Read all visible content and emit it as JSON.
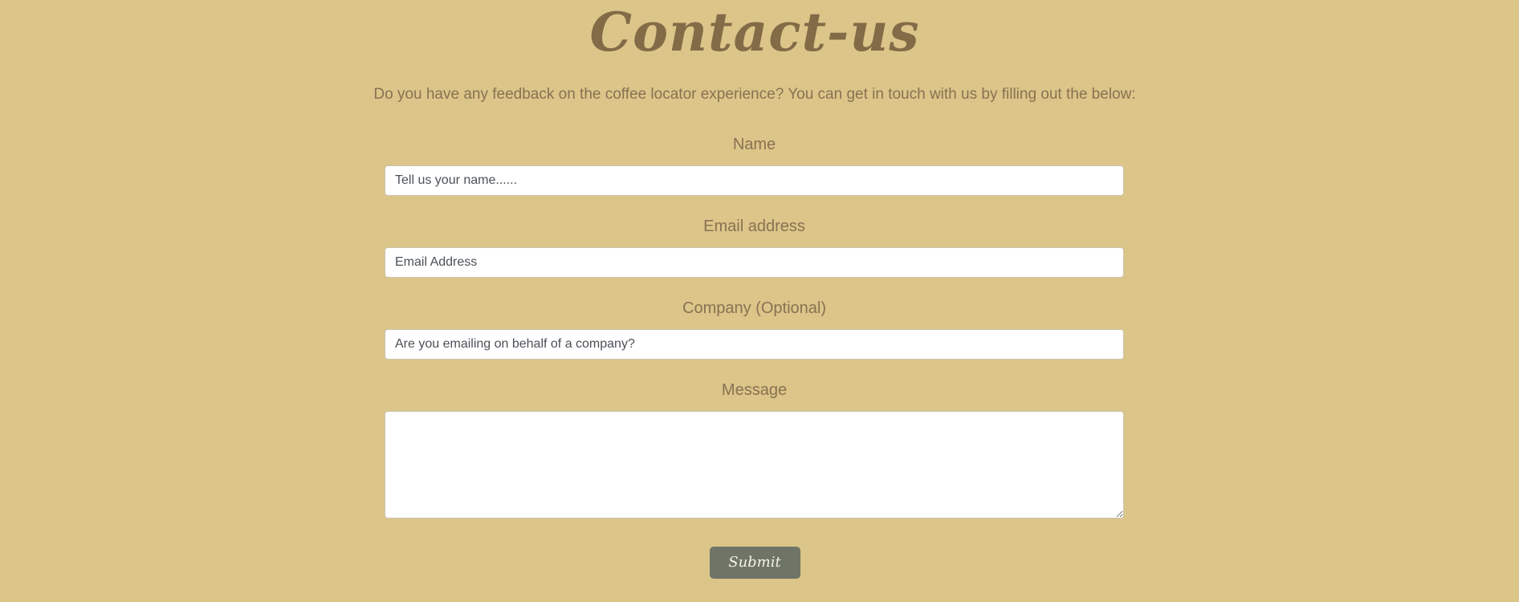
{
  "header": {
    "title": "Contact-us",
    "intro": "Do you have any feedback on the coffee locator experience? You can get in touch with us by filling out the below:"
  },
  "form": {
    "name": {
      "label": "Name",
      "placeholder": "Tell us your name......"
    },
    "email": {
      "label": "Email address",
      "placeholder": "Email Address"
    },
    "company": {
      "label": "Company (Optional)",
      "placeholder": "Are you emailing on behalf of a company?"
    },
    "message": {
      "label": "Message",
      "value": ""
    },
    "submit_label": "Submit"
  },
  "colors": {
    "background": "#dbc589",
    "text": "#8a7152",
    "button": "#6f7566",
    "button_text": "#f4f1e6"
  }
}
